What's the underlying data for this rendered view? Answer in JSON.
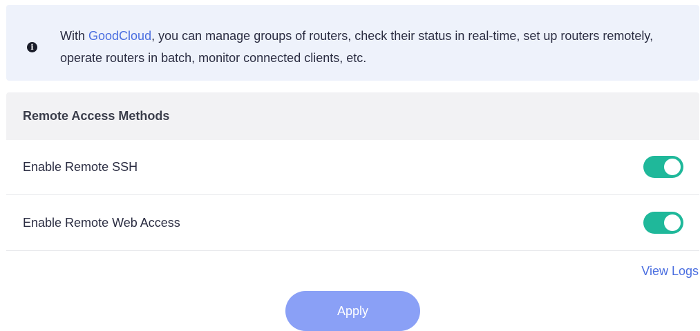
{
  "info_banner": {
    "icon": "info-circle-icon",
    "text_before": "With ",
    "link_text": "GoodCloud",
    "text_after": ", you can manage groups of routers, check their status in real-time, set up routers remotely, operate routers in batch, monitor connected clients, etc."
  },
  "section": {
    "title": "Remote Access Methods"
  },
  "settings": [
    {
      "label": "Enable Remote SSH",
      "enabled": true
    },
    {
      "label": "Enable Remote Web Access",
      "enabled": true
    }
  ],
  "view_logs_label": "View Logs",
  "apply_label": "Apply",
  "colors": {
    "accent": "#4a6ee0",
    "toggle_on": "#1fb89a",
    "apply_button": "#8aa0f6",
    "banner_bg": "#eef2fb"
  }
}
